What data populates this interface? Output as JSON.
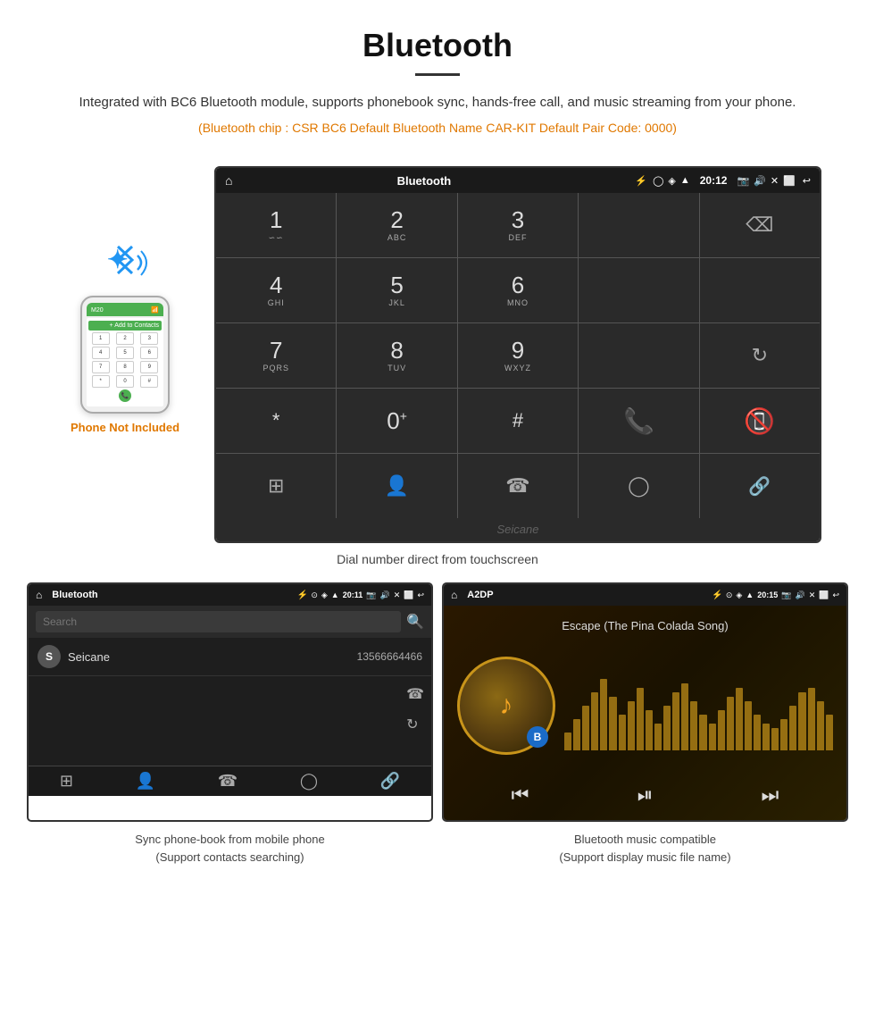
{
  "page": {
    "title": "Bluetooth",
    "description": "Integrated with BC6 Bluetooth module, supports phonebook sync, hands-free call, and music streaming from your phone.",
    "specs": "(Bluetooth chip : CSR BC6   Default Bluetooth Name CAR-KIT    Default Pair Code: 0000)",
    "phone_not_included": "Phone Not Included",
    "dial_caption": "Dial number direct from touchscreen",
    "phonebook_caption_line1": "Sync phone-book from mobile phone",
    "phonebook_caption_line2": "(Support contacts searching)",
    "music_caption_line1": "Bluetooth music compatible",
    "music_caption_line2": "(Support display music file name)"
  },
  "dial_screen": {
    "app_title": "Bluetooth",
    "time": "20:12",
    "keys": [
      {
        "num": "1",
        "sub": ""
      },
      {
        "num": "2",
        "sub": "ABC"
      },
      {
        "num": "3",
        "sub": "DEF"
      },
      {
        "num": "empty",
        "sub": ""
      },
      {
        "num": "backspace",
        "sub": ""
      },
      {
        "num": "4",
        "sub": "GHI"
      },
      {
        "num": "5",
        "sub": "JKL"
      },
      {
        "num": "6",
        "sub": "MNO"
      },
      {
        "num": "empty",
        "sub": ""
      },
      {
        "num": "empty",
        "sub": ""
      },
      {
        "num": "7",
        "sub": "PQRS"
      },
      {
        "num": "8",
        "sub": "TUV"
      },
      {
        "num": "9",
        "sub": "WXYZ"
      },
      {
        "num": "empty",
        "sub": ""
      },
      {
        "num": "redial",
        "sub": ""
      },
      {
        "num": "*",
        "sub": ""
      },
      {
        "num": "0+",
        "sub": ""
      },
      {
        "num": "#",
        "sub": ""
      },
      {
        "num": "call",
        "sub": ""
      },
      {
        "num": "hangup",
        "sub": ""
      }
    ]
  },
  "phonebook_screen": {
    "app_title": "Bluetooth",
    "time": "20:11",
    "search_placeholder": "Search",
    "contact_name": "Seicane",
    "contact_number": "13566664466"
  },
  "music_screen": {
    "app_title": "A2DP",
    "time": "20:15",
    "song_title": "Escape (The Pina Colada Song)",
    "visualizer_bars": [
      20,
      35,
      50,
      65,
      80,
      60,
      40,
      55,
      70,
      45,
      30,
      50,
      65,
      75,
      55,
      40,
      30,
      45,
      60,
      70,
      55,
      40,
      30,
      25,
      35,
      50,
      65,
      70,
      55,
      40
    ]
  },
  "icons": {
    "bluetooth": "ᛒ",
    "home": "⌂",
    "back": "↩",
    "usb": "⚡",
    "camera": "📷",
    "speaker": "🔊",
    "close": "✕",
    "screen": "⬜",
    "search": "🔍",
    "prev": "⏮",
    "play_pause": "⏯",
    "next": "⏭"
  }
}
